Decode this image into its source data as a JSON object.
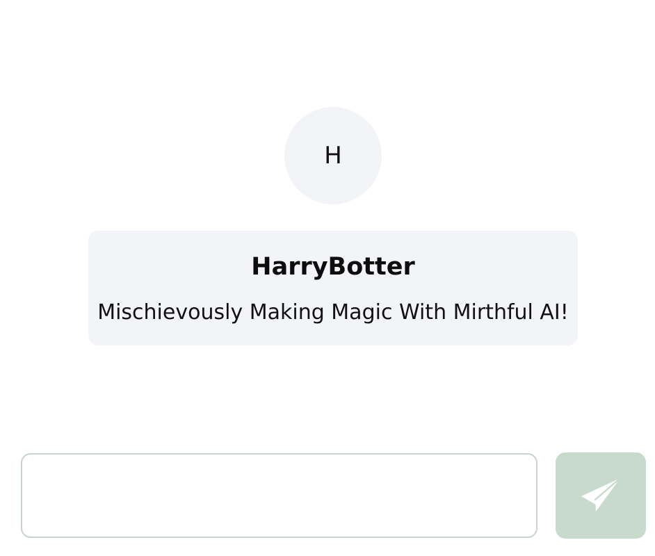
{
  "bot": {
    "avatar_initial": "H",
    "name": "HarryBotter",
    "description": "Mischievously Making Magic With Mirthful AI!"
  },
  "composer": {
    "placeholder": "",
    "value": "",
    "send_icon": "paper-plane-icon"
  },
  "colors": {
    "card_background": "#f3f4f8",
    "send_button_background": "#c8dacb",
    "input_border": "#c7d3cf",
    "icon": "#ffffff"
  }
}
